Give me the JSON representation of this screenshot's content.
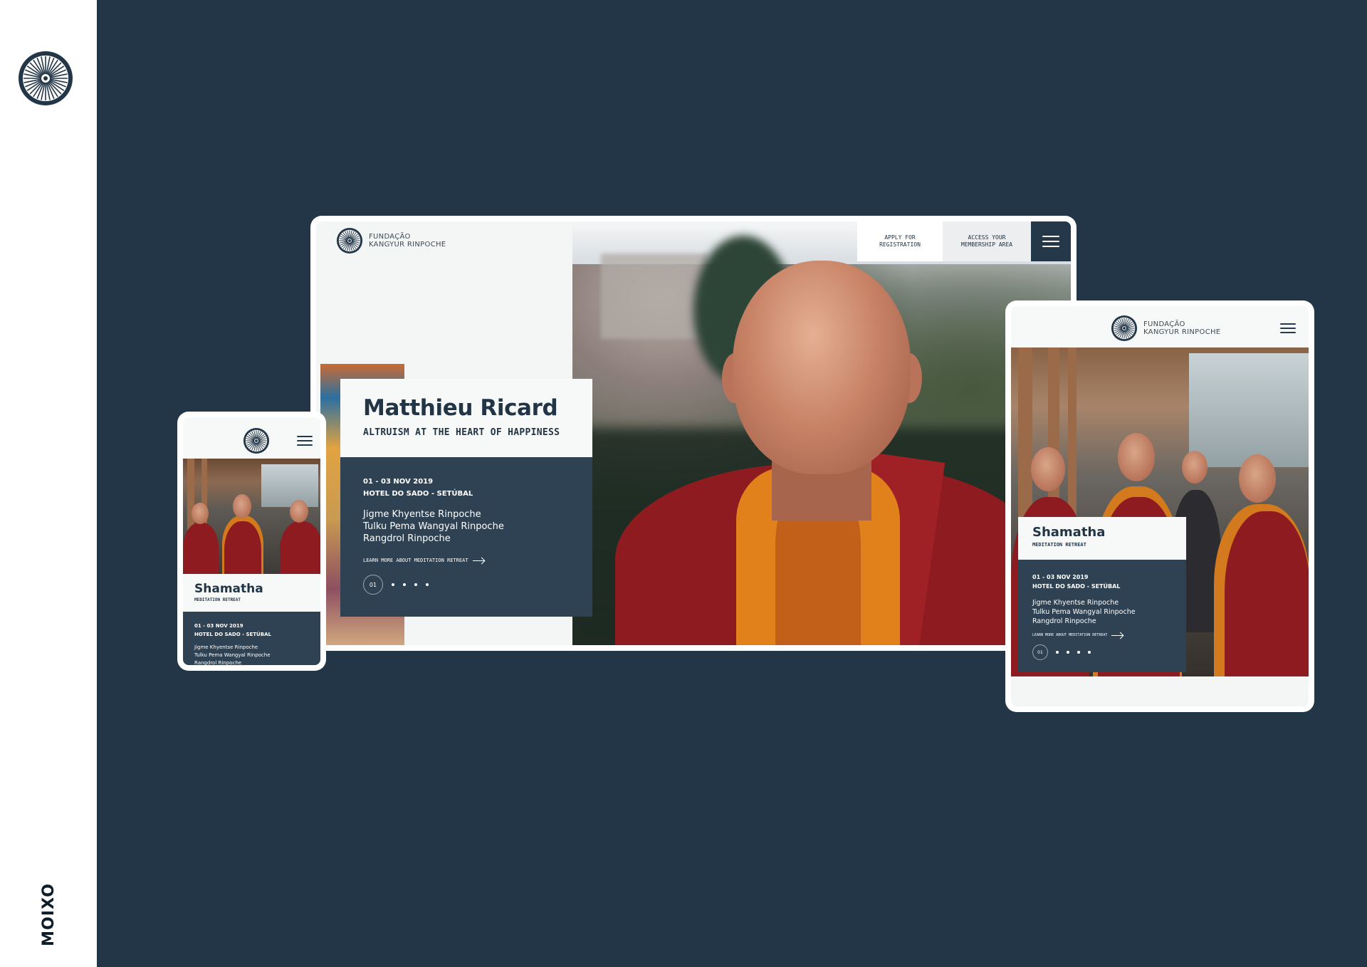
{
  "brand": {
    "wordmark": "MOIXO"
  },
  "desktop": {
    "logo_line1": "FUNDAÇÃO",
    "logo_line2": "KANGYUR RINPOCHE",
    "nav": {
      "apply_line1": "APPLY FOR",
      "apply_line2": "REGISTRATION",
      "access_line1": "ACCESS YOUR",
      "access_line2": "MEMBERSHIP AREA"
    },
    "hero": {
      "title": "Matthieu Ricard",
      "subtitle": "ALTRUISM AT THE HEART OF HAPPINESS",
      "date": "01 - 03 NOV 2019",
      "venue": "HOTEL DO SADO - SETÚBAL",
      "names": [
        "Jigme Khyentse Rinpoche",
        "Tulku Pema Wangyal Rinpoche",
        "Rangdrol Rinpoche"
      ],
      "learn_more": "LEARN MORE ABOUT MEDITATION RETREAT",
      "page": "01"
    }
  },
  "mobile": {
    "title": "Shamatha",
    "subtitle": "MEDITATION RETREAT",
    "date": "01 - 03 NOV 2019",
    "venue": "HOTEL DO SADO - SETÚBAL",
    "names": [
      "Jigme Khyentse Rinpoche",
      "Tulku Pema Wangyal Rinpoche",
      "Rangdrol Rinpoche"
    ]
  },
  "tablet": {
    "logo_line1": "FUNDAÇÃO",
    "logo_line2": "KANGYUR RINPOCHE",
    "title": "Shamatha",
    "subtitle": "MEDITATION RETREAT",
    "date": "01 - 03 NOV 2019",
    "venue": "HOTEL DO SADO - SETÚBAL",
    "names": [
      "Jigme Khyentse Rinpoche",
      "Tulku Pema Wangyal Rinpoche",
      "Rangdrol Rinpoche"
    ],
    "learn_more": "LEARN MORE ABOUT MEDITATION RETREAT",
    "page": "01"
  },
  "colors": {
    "navy": "#233647",
    "card": "#2f4253",
    "robe": "#8e1b1f",
    "saffron": "#e1811b"
  },
  "icons": {
    "logo": "dharma-wheel-icon",
    "menu": "hamburger-menu-icon",
    "arrow": "arrow-right-icon"
  }
}
